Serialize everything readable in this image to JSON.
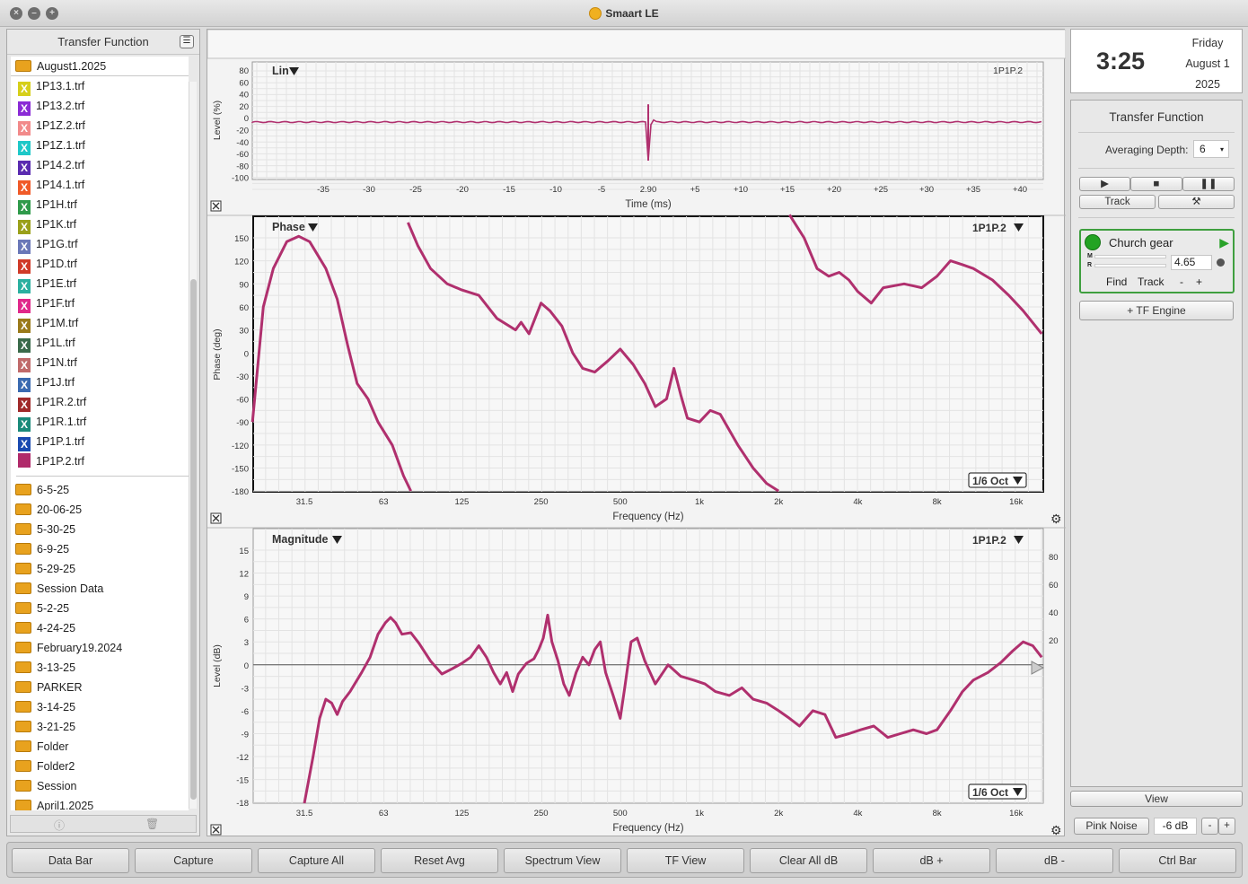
{
  "app_title": "Smaart LE",
  "left": {
    "title": "Transfer Function",
    "open_folder": "August1.2025",
    "files": [
      {
        "name": "1P13.1.trf",
        "color": "#d6cf1a"
      },
      {
        "name": "1P13.2.trf",
        "color": "#8a2bd6"
      },
      {
        "name": "1P1Z.2.trf",
        "color": "#f28a8a"
      },
      {
        "name": "1P1Z.1.trf",
        "color": "#1ec8c8"
      },
      {
        "name": "1P14.2.trf",
        "color": "#5a2bb0"
      },
      {
        "name": "1P14.1.trf",
        "color": "#f05a28"
      },
      {
        "name": "1P1H.trf",
        "color": "#2f9a4a"
      },
      {
        "name": "1P1K.trf",
        "color": "#9aa01a"
      },
      {
        "name": "1P1G.trf",
        "color": "#6a78b8"
      },
      {
        "name": "1P1D.trf",
        "color": "#d03a28"
      },
      {
        "name": "1P1E.trf",
        "color": "#2ab0a0"
      },
      {
        "name": "1P1F.trf",
        "color": "#e0288a"
      },
      {
        "name": "1P1M.trf",
        "color": "#9a7a1a"
      },
      {
        "name": "1P1L.trf",
        "color": "#3a6a4a"
      },
      {
        "name": "1P1N.trf",
        "color": "#c06a6a"
      },
      {
        "name": "1P1J.trf",
        "color": "#3a6ab0"
      },
      {
        "name": "1P1R.2.trf",
        "color": "#a02a2a"
      },
      {
        "name": "1P1R.1.trf",
        "color": "#1a8a7a"
      },
      {
        "name": "1P1P.1.trf",
        "color": "#1a4ab0"
      },
      {
        "name": "1P1P.2.trf",
        "color": "#b02a6a"
      }
    ],
    "folders": [
      "6-5-25",
      "20-06-25",
      "5-30-25",
      "6-9-25",
      "5-29-25",
      "Session Data",
      "5-2-25",
      "4-24-25",
      "February19.2024",
      "3-13-25",
      "PARKER",
      "3-14-25",
      "3-21-25",
      "Folder",
      "Folder2",
      "Session",
      "April1.2025"
    ]
  },
  "clock": {
    "time": "3:25",
    "day": "Friday",
    "date": "August 1",
    "year": "2025"
  },
  "tf": {
    "title": "Transfer Function",
    "avg_label": "Averaging Depth:",
    "avg_value": "6",
    "track_label": "Track",
    "engine": {
      "name": "Church gear",
      "delay": "4.65",
      "m": "M",
      "r": "R",
      "find": "Find",
      "track": "Track",
      "minus": "-",
      "plus": "+"
    },
    "add_engine": "+ TF Engine",
    "view": "View",
    "noise_label": "Pink Noise",
    "noise_level": "-6 dB",
    "minus": "-",
    "plus": "+"
  },
  "plots": {
    "ir": {
      "title": "Lin",
      "trace": "1P1P.2",
      "ylabel": "Level (%)",
      "xlabel": "Time (ms)",
      "yticks": [
        "80",
        "60",
        "40",
        "20",
        "0",
        "-20",
        "-40",
        "-60",
        "-80",
        "-100"
      ],
      "xticks": [
        "-35",
        "-30",
        "-25",
        "-20",
        "-15",
        "-10",
        "-5",
        "2.90",
        "+5",
        "+10",
        "+15",
        "+20",
        "+25",
        "+30",
        "+35",
        "+40"
      ]
    },
    "phase": {
      "title": "Phase",
      "trace": "1P1P.2",
      "ylabel": "Phase (deg)",
      "xlabel": "Frequency (Hz)",
      "smoothing": "1/6 Oct",
      "yticks": [
        "150",
        "120",
        "90",
        "60",
        "30",
        "0",
        "-30",
        "-60",
        "-90",
        "-120",
        "-150",
        "-180"
      ]
    },
    "mag": {
      "title": "Magnitude",
      "trace": "1P1P.2",
      "ylabel": "Level (dB)",
      "xlabel": "Frequency (Hz)",
      "smoothing": "1/6 Oct",
      "yticks": [
        "15",
        "12",
        "9",
        "6",
        "3",
        "0",
        "-3",
        "-6",
        "-9",
        "-12",
        "-15",
        "-18"
      ],
      "cticks": [
        "80",
        "60",
        "40",
        "20"
      ]
    },
    "freq_ticks": [
      "31.5",
      "63",
      "125",
      "250",
      "500",
      "1k",
      "2k",
      "4k",
      "8k",
      "16k"
    ]
  },
  "bottom_buttons": [
    "Data Bar",
    "Capture",
    "Capture All",
    "Reset Avg",
    "Spectrum View",
    "TF View",
    "Clear All dB",
    "dB +",
    "dB -",
    "Ctrl Bar"
  ],
  "colors": {
    "trace": "#b0306e",
    "grid": "#e3e3e3"
  }
}
